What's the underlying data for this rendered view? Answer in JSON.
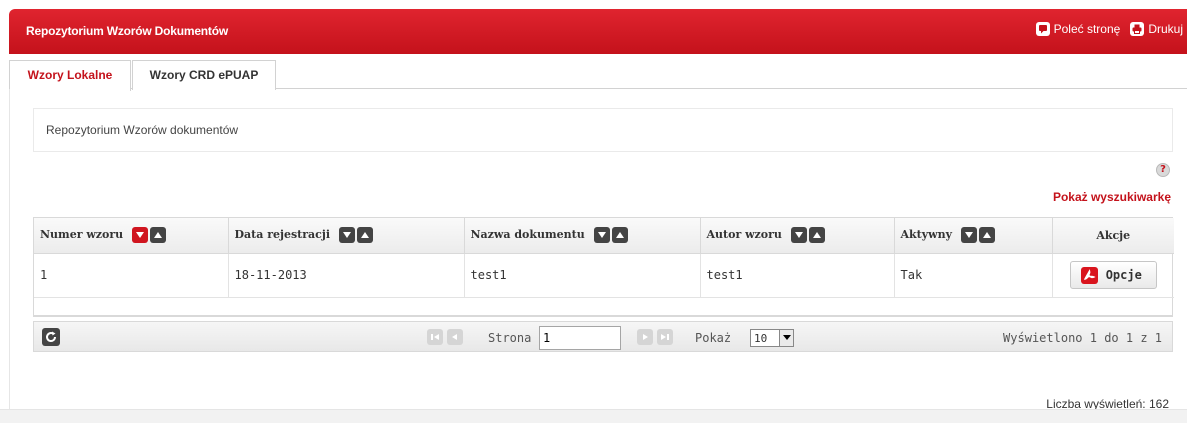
{
  "header": {
    "title": "Repozytorium Wzorów Dokumentów",
    "actions": [
      {
        "label": "Poleć stronę",
        "icon": "recommend-icon"
      },
      {
        "label": "Drukuj",
        "icon": "print-icon"
      }
    ]
  },
  "tabs": [
    {
      "label": "Wzory Lokalne",
      "active": true
    },
    {
      "label": "Wzory CRD ePUAP",
      "active": false
    }
  ],
  "description": "Repozytorium Wzorów dokumentów",
  "help_icon": "help-icon",
  "search_toggle": "Pokaż wyszukiwarkę",
  "table": {
    "columns": [
      "Numer wzoru",
      "Data rejestracji",
      "Nazwa dokumentu",
      "Autor wzoru",
      "Aktywny",
      "Akcje"
    ],
    "rows": [
      {
        "numer": "1",
        "data": "18-11-2013",
        "nazwa": "test1",
        "autor": "test1",
        "aktywny": "Tak",
        "akcja": "Opcje"
      }
    ]
  },
  "pager": {
    "page_label": "Strona",
    "page_value": "1",
    "show_label": "Pokaż",
    "page_size": "10",
    "status": "Wyświetlono 1 do 1 z 1"
  },
  "view_count": "Liczba wyświetleń: 162",
  "colors": {
    "brand_red": "#c4121b",
    "sort_active": "#d0151f"
  }
}
